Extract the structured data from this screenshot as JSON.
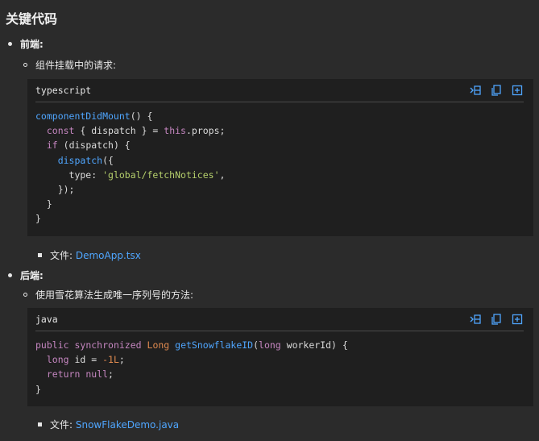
{
  "heading": "关键代码",
  "frontend": {
    "label": "前端:",
    "sub_label": "组件挂载中的请求:",
    "code_lang": "typescript",
    "file_prefix": "文件: ",
    "file_name": "DemoApp.tsx"
  },
  "backend": {
    "label": "后端:",
    "sub_label": "使用雪花算法生成唯一序列号的方法:",
    "code_lang": "java",
    "file_prefix": "文件: ",
    "file_name": "SnowFlakeDemo.java"
  },
  "toolbar_icons": [
    "wrap-icon",
    "copy-icon",
    "expand-icon"
  ],
  "colors": {
    "background": "#2b2b2b",
    "code_background": "#1f1f1f",
    "link": "#4fa6ff",
    "keyword": "#c586c0",
    "function": "#4fa6ff",
    "string": "#b5cf6b"
  }
}
